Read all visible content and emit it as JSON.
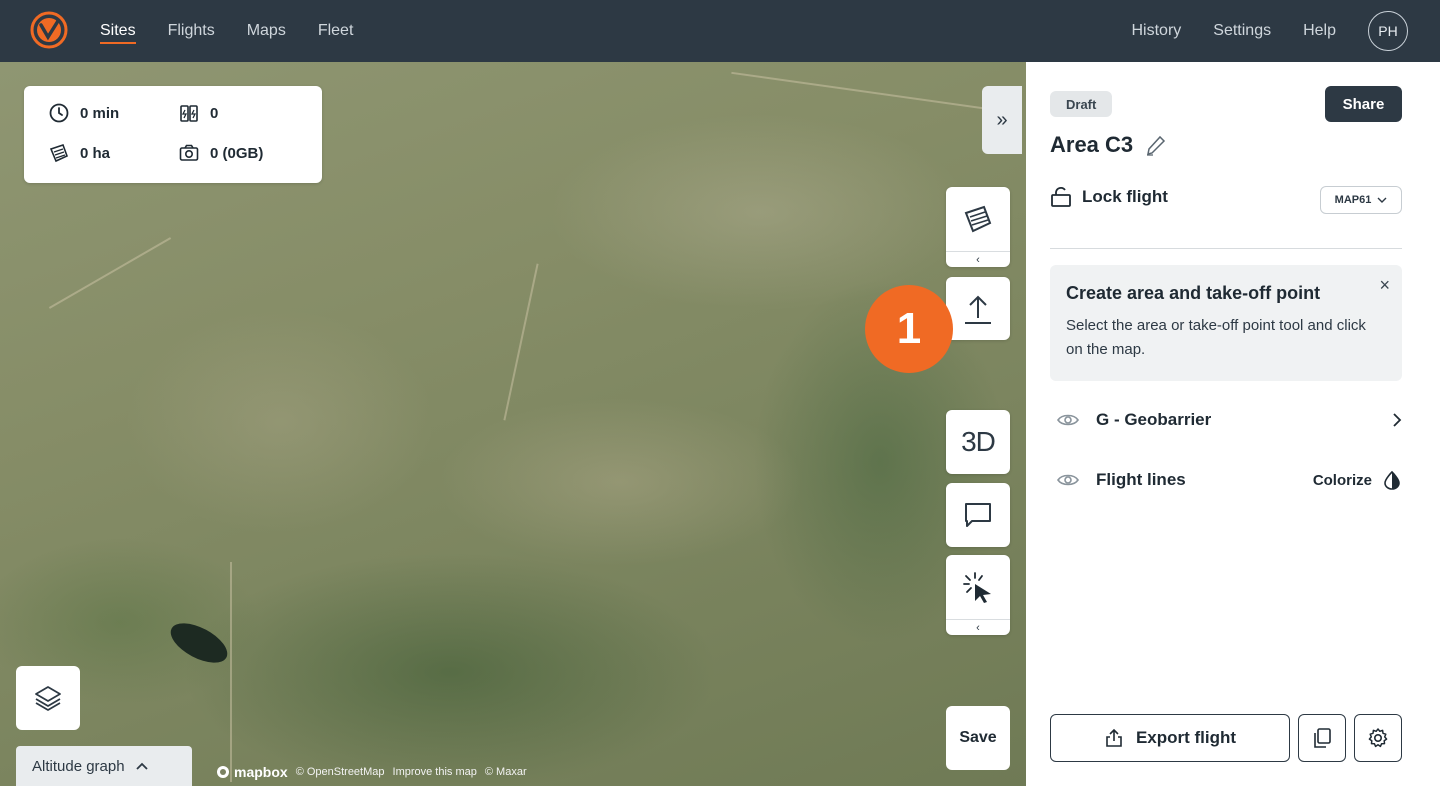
{
  "nav": {
    "logo_icon": "propeller-logo-icon",
    "items": [
      {
        "label": "Sites",
        "active": true
      },
      {
        "label": "Flights",
        "active": false
      },
      {
        "label": "Maps",
        "active": false
      },
      {
        "label": "Fleet",
        "active": false
      }
    ],
    "right_items": [
      "History",
      "Settings",
      "Help"
    ],
    "avatar_initials": "PH",
    "accent_color": "#f06a24",
    "bar_color": "#2d3944"
  },
  "stats": {
    "time": "0 min",
    "batteries": "0",
    "area": "0 ha",
    "photos": "0 (0GB)"
  },
  "map_tools": {
    "collapse_label": "»",
    "sub_arrow": "‹",
    "three_d_label": "3D",
    "step_badge": "1",
    "save_label": "Save",
    "altitude_label": "Altitude graph",
    "attribution": {
      "mapbox": "mapbox",
      "osm": "© OpenStreetMap",
      "improve": "Improve this map",
      "maxar": "© Maxar"
    }
  },
  "panel": {
    "status_tag": "Draft",
    "share_label": "Share",
    "title": "Area C3",
    "lock_label": "Lock flight",
    "drone_model": "MAP61",
    "info": {
      "title": "Create area and take-off point",
      "text": "Select the area or take-off point tool and click on the map.",
      "close": "×"
    },
    "layers": [
      {
        "name": "G - Geobarrier"
      },
      {
        "name": "Flight lines",
        "action": "Colorize"
      }
    ],
    "export_label": "Export flight"
  }
}
